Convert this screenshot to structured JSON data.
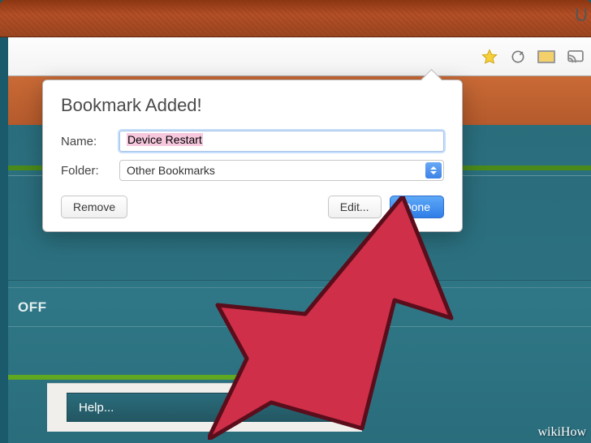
{
  "popup": {
    "title": "Bookmark Added!",
    "name_label": "Name:",
    "name_value": "Device Restart",
    "folder_label": "Folder:",
    "folder_value": "Other Bookmarks",
    "remove_label": "Remove",
    "edit_label": "Edit...",
    "done_label": "Done"
  },
  "page": {
    "off_label": "OFF",
    "help_label": "Help..."
  },
  "watermark": "wikiHow"
}
